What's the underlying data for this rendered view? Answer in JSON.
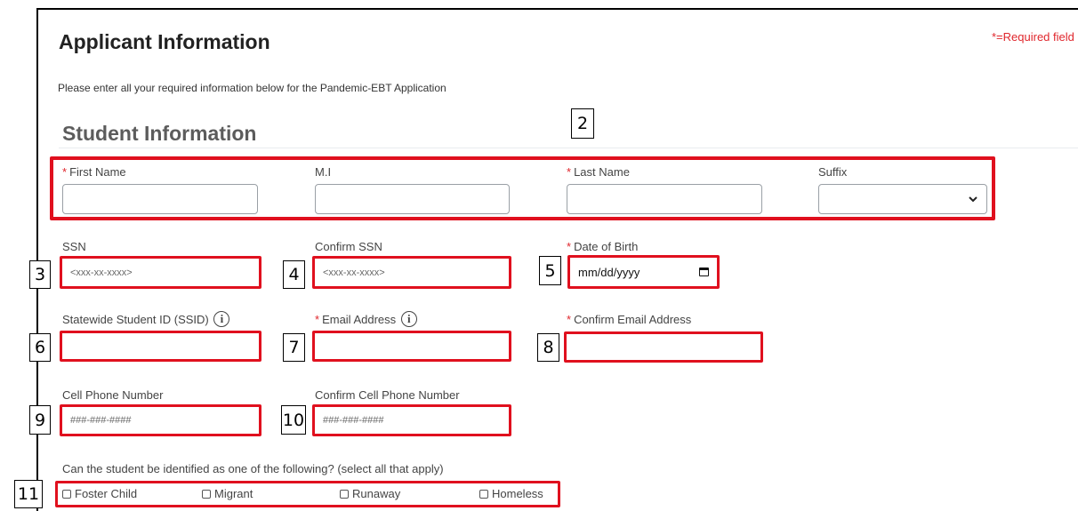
{
  "header": {
    "title": "Applicant Information",
    "required_note": "*=Required field",
    "intro": "Please enter all your required information below for the Pandemic-EBT Application"
  },
  "student": {
    "section_title": "Student Information",
    "required_mark": "*",
    "first_name": {
      "label": "First Name",
      "value": ""
    },
    "mi": {
      "label": "M.I",
      "value": ""
    },
    "last_name": {
      "label": "Last Name",
      "value": ""
    },
    "suffix": {
      "label": "Suffix",
      "selected": ""
    },
    "ssn": {
      "label": "SSN",
      "placeholder": "<xxx-xx-xxxx>"
    },
    "confirm_ssn": {
      "label": "Confirm SSN",
      "placeholder": "<xxx-xx-xxxx>"
    },
    "dob": {
      "label": "Date of Birth",
      "placeholder": "mm/dd/yyyy"
    },
    "ssid": {
      "label": "Statewide Student ID (SSID)",
      "value": ""
    },
    "email": {
      "label": "Email Address",
      "value": ""
    },
    "confirm_email": {
      "label": "Confirm Email Address",
      "value": ""
    },
    "cell": {
      "label": "Cell Phone Number",
      "placeholder": "###-###-####"
    },
    "confirm_cell": {
      "label": "Confirm Cell Phone Number",
      "placeholder": "###-###-####"
    },
    "categories": {
      "question": "Can the student be identified as one of the following? (select all that apply)",
      "options": [
        "Foster Child",
        "Migrant",
        "Runaway",
        "Homeless"
      ]
    }
  },
  "annotations": [
    "2",
    "3",
    "4",
    "5",
    "6",
    "7",
    "8",
    "9",
    "10",
    "11"
  ],
  "colors": {
    "highlight": "#e0101e",
    "required": "#e0262c"
  },
  "icons": {
    "info": "info-icon",
    "calendar": "calendar-icon",
    "chevron": "chevron-down-icon"
  }
}
